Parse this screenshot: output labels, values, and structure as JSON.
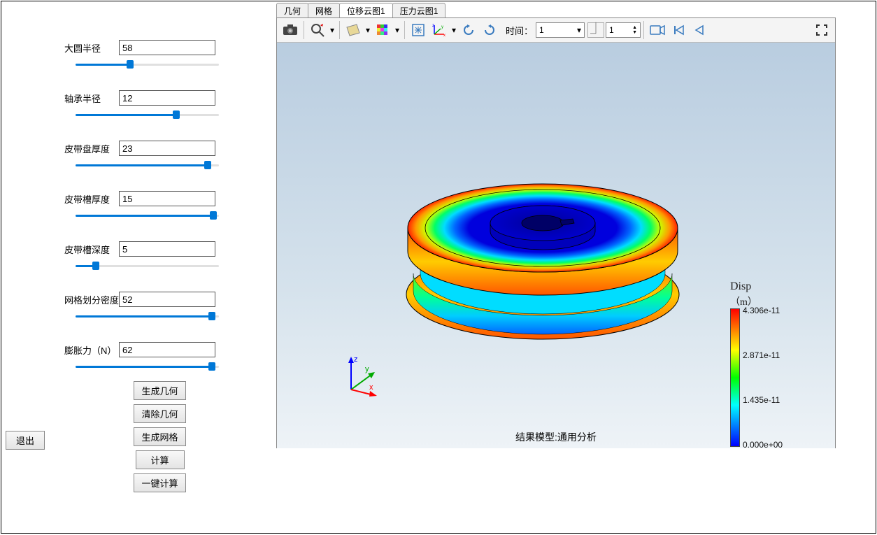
{
  "params": {
    "large_radius": {
      "label": "大圆半径",
      "value": "58",
      "percent": 38
    },
    "bearing_radius": {
      "label": "轴承半径",
      "value": "12",
      "percent": 70
    },
    "disc_thickness": {
      "label": "皮带盘厚度",
      "value": "23",
      "percent": 92
    },
    "groove_thickness": {
      "label": "皮带槽厚度",
      "value": "15",
      "percent": 96
    },
    "groove_depth": {
      "label": "皮带槽深度",
      "value": "5",
      "percent": 14
    },
    "mesh_density": {
      "label": "网格划分密度",
      "value": "52",
      "percent": 95
    },
    "expansion_force": {
      "label": "膨胀力（N）",
      "value": "62",
      "percent": 95
    }
  },
  "buttons": {
    "gen_geom": "生成几何",
    "clear_geom": "清除几何",
    "gen_mesh": "生成网格",
    "calculate": "计算",
    "one_click": "一键计算",
    "exit": "退出"
  },
  "tabs": {
    "geometry": "几何",
    "mesh": "网格",
    "disp_cloud": "位移云图1",
    "pressure_cloud": "压力云图1"
  },
  "toolbar": {
    "time_label": "时间：",
    "time_value": "1",
    "frame_value": "1"
  },
  "viewport": {
    "result_label": "结果模型:通用分析",
    "axis_x": "x",
    "axis_y": "y",
    "axis_z": "z"
  },
  "legend": {
    "title": "Disp",
    "unit": "（m）",
    "max": "4.306e-11",
    "mid_high": "2.871e-11",
    "mid_low": "1.435e-11",
    "min": "0.000e+00"
  }
}
